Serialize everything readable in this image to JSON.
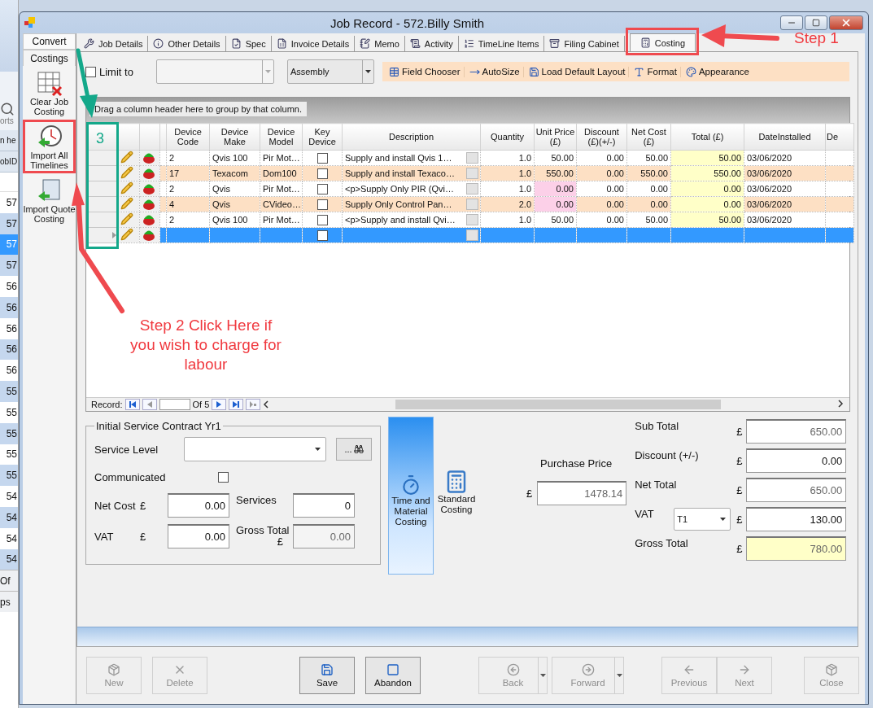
{
  "window": {
    "title": "Job Record - 572.Billy Smith"
  },
  "background_list": {
    "tab_label": "orts",
    "header_1": "n he",
    "header_2": "obID",
    "rows": [
      {
        "value": "57",
        "selected": false
      },
      {
        "value": "57",
        "selected": false
      },
      {
        "value": "57",
        "selected": true
      },
      {
        "value": "57",
        "selected": false
      },
      {
        "value": "56",
        "selected": false
      },
      {
        "value": "56",
        "selected": false
      },
      {
        "value": "56",
        "selected": false
      },
      {
        "value": "56",
        "selected": false
      },
      {
        "value": "56",
        "selected": false
      },
      {
        "value": "55",
        "selected": false
      },
      {
        "value": "55",
        "selected": false
      },
      {
        "value": "55",
        "selected": false
      },
      {
        "value": "55",
        "selected": false
      },
      {
        "value": "55",
        "selected": false
      },
      {
        "value": "54",
        "selected": false
      },
      {
        "value": "54",
        "selected": false
      },
      {
        "value": "54",
        "selected": false
      },
      {
        "value": "54",
        "selected": false
      }
    ],
    "footer_1": "Of",
    "footer_2": "ps"
  },
  "side_tabs": [
    {
      "label": "Convert",
      "selected": false
    },
    {
      "label": "Costings",
      "selected": true
    }
  ],
  "side_actions": [
    {
      "label": "Clear Job Costing",
      "kind": "clear"
    },
    {
      "label": "Import All Timelines",
      "kind": "timelines"
    },
    {
      "label": "Import Quote Costing",
      "kind": "quote"
    }
  ],
  "tabs": [
    {
      "label": "Job Details",
      "selected": false
    },
    {
      "label": "Other Details",
      "selected": false
    },
    {
      "label": "Spec",
      "selected": false
    },
    {
      "label": "Invoice Details",
      "selected": false
    },
    {
      "label": "Memo",
      "selected": false
    },
    {
      "label": "Activity",
      "selected": false
    },
    {
      "label": "TimeLine Items",
      "selected": false
    },
    {
      "label": "Filing Cabinet",
      "selected": false
    },
    {
      "label": "Costing",
      "selected": true
    }
  ],
  "toolbar": {
    "limit_to": {
      "label": "Limit to",
      "checked": false
    },
    "group_select": "Assembly",
    "actions": [
      "Field Chooser",
      "AutoSize",
      "Load Default Layout",
      "Format",
      "Appearance"
    ]
  },
  "grid": {
    "group_hint": "Drag a column header here to group by that column.",
    "columns": [
      "Device Code",
      "Device Make",
      "Device Model",
      "Key Device",
      "Description",
      "Quantity",
      "Unit Price (£)",
      "Discount (£)(+/-)",
      "Net Cost (£)",
      "Total (£)",
      "DateInstalled",
      "De"
    ],
    "rows": [
      {
        "code": "2",
        "make": "Qvis 100",
        "model": "Pir Mot…",
        "key_device": false,
        "description": "Supply and install Qvis 1…",
        "quantity": "1.0",
        "unit_price": "50.00",
        "discount": "0.00",
        "net_cost": "50.00",
        "total": "50.00",
        "date": "03/06/2020",
        "price_flagged": false,
        "selected": false
      },
      {
        "code": "17",
        "make": "Texacom",
        "model": "Dom100",
        "key_device": false,
        "description": "Supply and install Texaco…",
        "quantity": "1.0",
        "unit_price": "550.00",
        "discount": "0.00",
        "net_cost": "550.00",
        "total": "550.00",
        "date": "03/06/2020",
        "price_flagged": false,
        "selected": false
      },
      {
        "code": "2",
        "make": "Qvis",
        "model": "Pir Mot…",
        "key_device": false,
        "description": "<p>Supply Only PIR (Qvi…",
        "quantity": "1.0",
        "unit_price": "0.00",
        "discount": "0.00",
        "net_cost": "0.00",
        "total": "0.00",
        "date": "03/06/2020",
        "price_flagged": true,
        "selected": false
      },
      {
        "code": "4",
        "make": "Qvis",
        "model": "CVideo…",
        "key_device": false,
        "description": "Supply Only Control Pan…",
        "quantity": "2.0",
        "unit_price": "0.00",
        "discount": "0.00",
        "net_cost": "0.00",
        "total": "0.00",
        "date": "03/06/2020",
        "price_flagged": true,
        "selected": false
      },
      {
        "code": "2",
        "make": "Qvis 100",
        "model": "Pir Mot…",
        "key_device": false,
        "description": "<p>Supply and install Qvi…",
        "quantity": "1.0",
        "unit_price": "50.00",
        "discount": "0.00",
        "net_cost": "50.00",
        "total": "50.00",
        "date": "03/06/2020",
        "price_flagged": false,
        "selected": false
      },
      {
        "key_device": false,
        "price_flagged": false,
        "selected": true
      }
    ],
    "navigator": {
      "label": "Record:",
      "of": "Of",
      "count": "5"
    }
  },
  "service_contract": {
    "title": "Initial Service Contract Yr1",
    "service_level_label": "Service Level",
    "browse_button": "...",
    "communicated": {
      "label": "Communicated",
      "checked": false
    },
    "net_cost_label": "Net Cost",
    "net_cost_currency": "£",
    "net_cost": "0.00",
    "services_label": "Services",
    "services": "0",
    "vat_label": "VAT",
    "vat_currency": "£",
    "vat": "0.00",
    "gross_total_label": "Gross Total",
    "gross_total_currency": "£",
    "gross_total": "0.00"
  },
  "costing_modes": [
    {
      "label": "Time and Material Costing",
      "selected": true
    },
    {
      "label": "Standard Costing",
      "selected": false
    }
  ],
  "purchase": {
    "label": "Purchase Price",
    "currency": "£",
    "value": "1478.14"
  },
  "totals": [
    {
      "label": "Sub Total",
      "currency": "£",
      "value": "650.00",
      "kind": "readonly"
    },
    {
      "label": "Discount (+/-)",
      "currency": "£",
      "value": "0.00",
      "kind": "editable"
    },
    {
      "label": "Net Total",
      "currency": "£",
      "value": "650.00",
      "kind": "readonly"
    },
    {
      "label": "VAT",
      "code": "T1",
      "currency": "£",
      "value": "130.00",
      "kind": "vat"
    },
    {
      "label": "Gross Total",
      "currency": "£",
      "value": "780.00",
      "kind": "highlight"
    }
  ],
  "button_groups": [
    [
      {
        "label": "New",
        "kind": "new",
        "disabled": true
      },
      {
        "label": "Delete",
        "kind": "delete",
        "disabled": true
      }
    ],
    [
      {
        "label": "Save",
        "kind": "save",
        "disabled": false
      },
      {
        "label": "Abandon",
        "kind": "abandon",
        "disabled": false
      }
    ],
    [
      {
        "label": "Back",
        "kind": "back",
        "disabled": true
      },
      {
        "label": "Forward",
        "kind": "forward",
        "disabled": true
      }
    ],
    [
      {
        "label": "Previous",
        "kind": "previous",
        "disabled": true
      },
      {
        "label": "Next",
        "kind": "next",
        "disabled": true
      }
    ],
    [
      {
        "label": "Close",
        "kind": "close",
        "disabled": true
      }
    ]
  ],
  "annotations": {
    "step_1": "Step 1",
    "step_2": "Step 2 Click Here if you wish to charge for labour",
    "marker": "3"
  }
}
